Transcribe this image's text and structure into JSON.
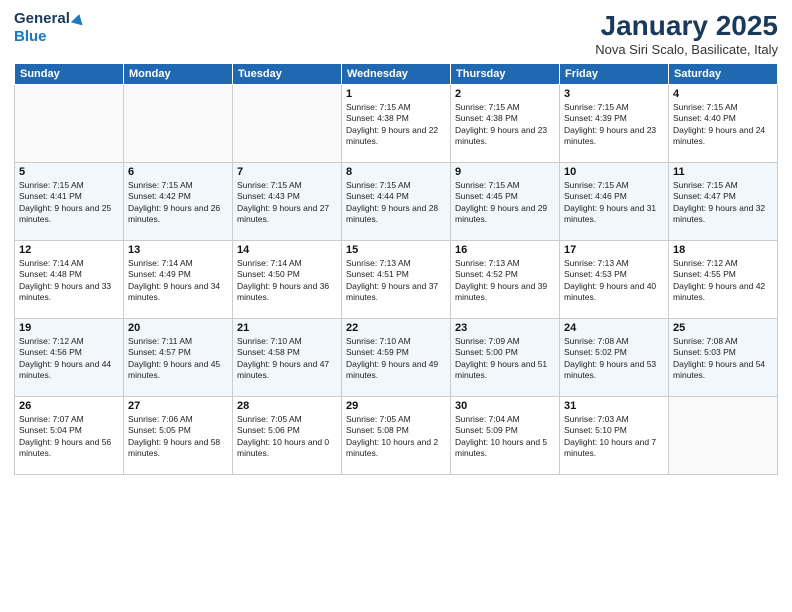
{
  "logo": {
    "line1": "General",
    "line2": "Blue"
  },
  "title": "January 2025",
  "subtitle": "Nova Siri Scalo, Basilicate, Italy",
  "weekdays": [
    "Sunday",
    "Monday",
    "Tuesday",
    "Wednesday",
    "Thursday",
    "Friday",
    "Saturday"
  ],
  "weeks": [
    [
      {
        "day": "",
        "info": ""
      },
      {
        "day": "",
        "info": ""
      },
      {
        "day": "",
        "info": ""
      },
      {
        "day": "1",
        "info": "Sunrise: 7:15 AM\nSunset: 4:38 PM\nDaylight: 9 hours and 22 minutes."
      },
      {
        "day": "2",
        "info": "Sunrise: 7:15 AM\nSunset: 4:38 PM\nDaylight: 9 hours and 23 minutes."
      },
      {
        "day": "3",
        "info": "Sunrise: 7:15 AM\nSunset: 4:39 PM\nDaylight: 9 hours and 23 minutes."
      },
      {
        "day": "4",
        "info": "Sunrise: 7:15 AM\nSunset: 4:40 PM\nDaylight: 9 hours and 24 minutes."
      }
    ],
    [
      {
        "day": "5",
        "info": "Sunrise: 7:15 AM\nSunset: 4:41 PM\nDaylight: 9 hours and 25 minutes."
      },
      {
        "day": "6",
        "info": "Sunrise: 7:15 AM\nSunset: 4:42 PM\nDaylight: 9 hours and 26 minutes."
      },
      {
        "day": "7",
        "info": "Sunrise: 7:15 AM\nSunset: 4:43 PM\nDaylight: 9 hours and 27 minutes."
      },
      {
        "day": "8",
        "info": "Sunrise: 7:15 AM\nSunset: 4:44 PM\nDaylight: 9 hours and 28 minutes."
      },
      {
        "day": "9",
        "info": "Sunrise: 7:15 AM\nSunset: 4:45 PM\nDaylight: 9 hours and 29 minutes."
      },
      {
        "day": "10",
        "info": "Sunrise: 7:15 AM\nSunset: 4:46 PM\nDaylight: 9 hours and 31 minutes."
      },
      {
        "day": "11",
        "info": "Sunrise: 7:15 AM\nSunset: 4:47 PM\nDaylight: 9 hours and 32 minutes."
      }
    ],
    [
      {
        "day": "12",
        "info": "Sunrise: 7:14 AM\nSunset: 4:48 PM\nDaylight: 9 hours and 33 minutes."
      },
      {
        "day": "13",
        "info": "Sunrise: 7:14 AM\nSunset: 4:49 PM\nDaylight: 9 hours and 34 minutes."
      },
      {
        "day": "14",
        "info": "Sunrise: 7:14 AM\nSunset: 4:50 PM\nDaylight: 9 hours and 36 minutes."
      },
      {
        "day": "15",
        "info": "Sunrise: 7:13 AM\nSunset: 4:51 PM\nDaylight: 9 hours and 37 minutes."
      },
      {
        "day": "16",
        "info": "Sunrise: 7:13 AM\nSunset: 4:52 PM\nDaylight: 9 hours and 39 minutes."
      },
      {
        "day": "17",
        "info": "Sunrise: 7:13 AM\nSunset: 4:53 PM\nDaylight: 9 hours and 40 minutes."
      },
      {
        "day": "18",
        "info": "Sunrise: 7:12 AM\nSunset: 4:55 PM\nDaylight: 9 hours and 42 minutes."
      }
    ],
    [
      {
        "day": "19",
        "info": "Sunrise: 7:12 AM\nSunset: 4:56 PM\nDaylight: 9 hours and 44 minutes."
      },
      {
        "day": "20",
        "info": "Sunrise: 7:11 AM\nSunset: 4:57 PM\nDaylight: 9 hours and 45 minutes."
      },
      {
        "day": "21",
        "info": "Sunrise: 7:10 AM\nSunset: 4:58 PM\nDaylight: 9 hours and 47 minutes."
      },
      {
        "day": "22",
        "info": "Sunrise: 7:10 AM\nSunset: 4:59 PM\nDaylight: 9 hours and 49 minutes."
      },
      {
        "day": "23",
        "info": "Sunrise: 7:09 AM\nSunset: 5:00 PM\nDaylight: 9 hours and 51 minutes."
      },
      {
        "day": "24",
        "info": "Sunrise: 7:08 AM\nSunset: 5:02 PM\nDaylight: 9 hours and 53 minutes."
      },
      {
        "day": "25",
        "info": "Sunrise: 7:08 AM\nSunset: 5:03 PM\nDaylight: 9 hours and 54 minutes."
      }
    ],
    [
      {
        "day": "26",
        "info": "Sunrise: 7:07 AM\nSunset: 5:04 PM\nDaylight: 9 hours and 56 minutes."
      },
      {
        "day": "27",
        "info": "Sunrise: 7:06 AM\nSunset: 5:05 PM\nDaylight: 9 hours and 58 minutes."
      },
      {
        "day": "28",
        "info": "Sunrise: 7:05 AM\nSunset: 5:06 PM\nDaylight: 10 hours and 0 minutes."
      },
      {
        "day": "29",
        "info": "Sunrise: 7:05 AM\nSunset: 5:08 PM\nDaylight: 10 hours and 2 minutes."
      },
      {
        "day": "30",
        "info": "Sunrise: 7:04 AM\nSunset: 5:09 PM\nDaylight: 10 hours and 5 minutes."
      },
      {
        "day": "31",
        "info": "Sunrise: 7:03 AM\nSunset: 5:10 PM\nDaylight: 10 hours and 7 minutes."
      },
      {
        "day": "",
        "info": ""
      }
    ]
  ]
}
